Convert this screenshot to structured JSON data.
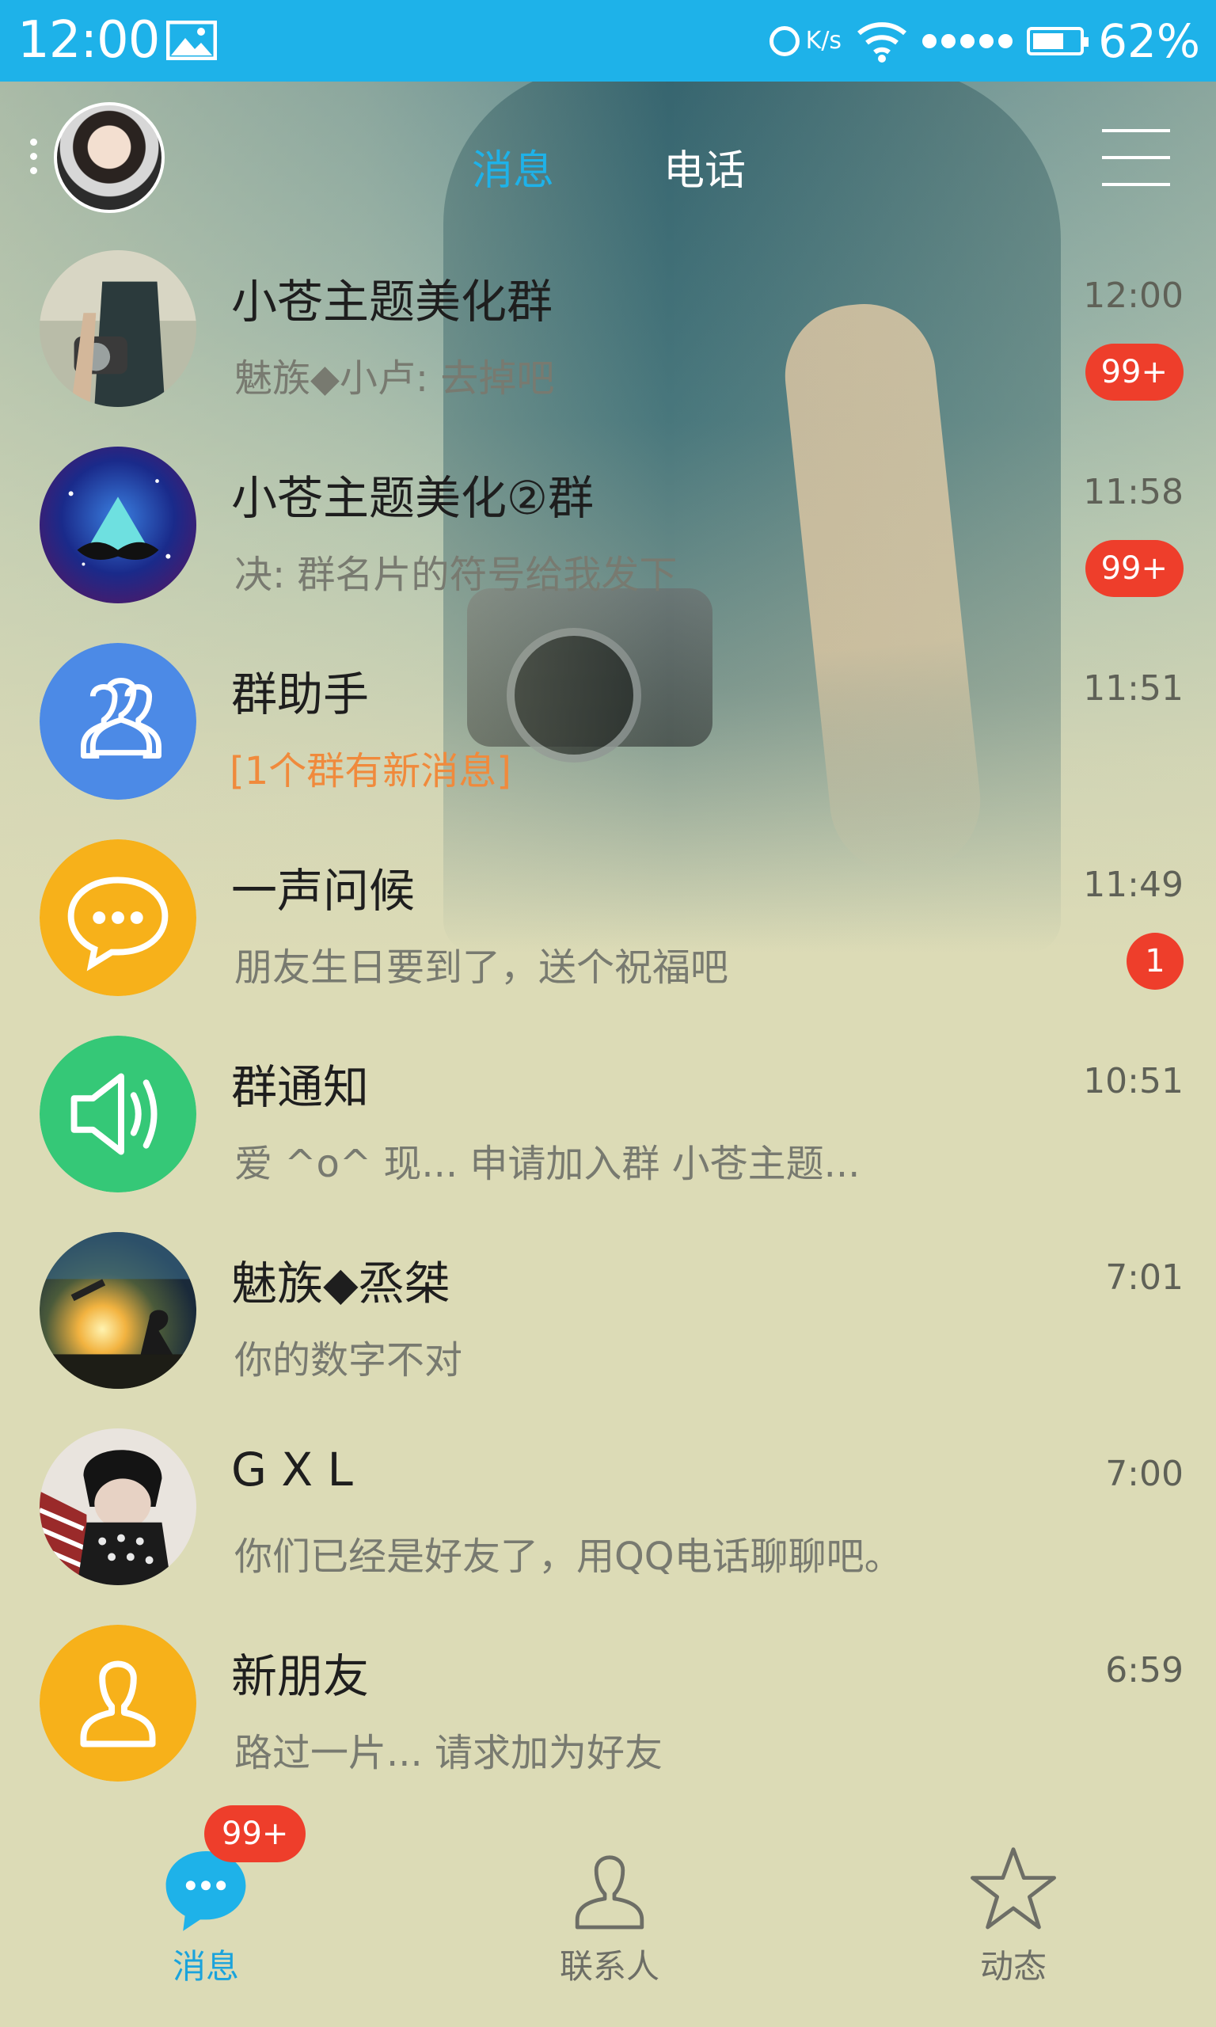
{
  "status_bar": {
    "time": "12:00",
    "net_speed": "K/s",
    "battery_percent": "62%",
    "icons": [
      "image-icon",
      "circle-status-icon",
      "wifi-icon",
      "signal-dots-icon",
      "battery-icon"
    ]
  },
  "header": {
    "tabs": [
      {
        "label": "消息",
        "active": true
      },
      {
        "label": "电话",
        "active": false
      }
    ],
    "menu_icon": "hamburger-menu-icon"
  },
  "conversations": [
    {
      "title": "小苍主题美化群",
      "preview": "魅族◆小卢: 去掉吧",
      "time": "12:00",
      "badge": "99+",
      "avatar": "camera-photo-avatar"
    },
    {
      "title": "小苍主题美化②群",
      "preview": "决: 群名片的符号给我发下",
      "time": "11:58",
      "badge": "99+",
      "avatar": "mustache-galaxy-avatar"
    },
    {
      "title": "群助手",
      "preview": "[1个群有新消息]",
      "time": "11:51",
      "badge": "",
      "avatar": "group-helper-icon"
    },
    {
      "title": "一声问候",
      "preview": "朋友生日要到了，送个祝福吧",
      "time": "11:49",
      "badge": "1",
      "avatar": "chat-bubble-icon"
    },
    {
      "title": "群通知",
      "preview": "爱 ^o^ 现... 申请加入群 小苍主题...",
      "time": "10:51",
      "badge": "",
      "avatar": "speaker-icon"
    },
    {
      "title": "魅族◆烝桀",
      "preview": "你的数字不对",
      "time": "7:01",
      "badge": "",
      "avatar": "sunset-photo-avatar"
    },
    {
      "title": "G X L",
      "preview": "你们已经是好友了，用QQ电话聊聊吧。",
      "time": "7:00",
      "badge": "",
      "avatar": "portrait-photo-avatar"
    },
    {
      "title": "新朋友",
      "preview": "路过一片... 请求加为好友",
      "time": "6:59",
      "badge": "",
      "avatar": "new-friend-icon"
    }
  ],
  "bottom_nav": [
    {
      "label": "消息",
      "icon": "message-bubble-icon",
      "badge": "99+",
      "active": true
    },
    {
      "label": "联系人",
      "icon": "contacts-person-icon",
      "badge": "",
      "active": false
    },
    {
      "label": "动态",
      "icon": "star-icon",
      "badge": "",
      "active": false
    }
  ],
  "colors": {
    "status_bar": "#1eb2e9",
    "active_tab": "#1eb2e9",
    "badge": "#ee3e2b",
    "orange_text": "#f08a3c",
    "blue_avatar": "#4c8ae6",
    "yellow_avatar": "#f7b11a",
    "green_avatar": "#35c877"
  }
}
